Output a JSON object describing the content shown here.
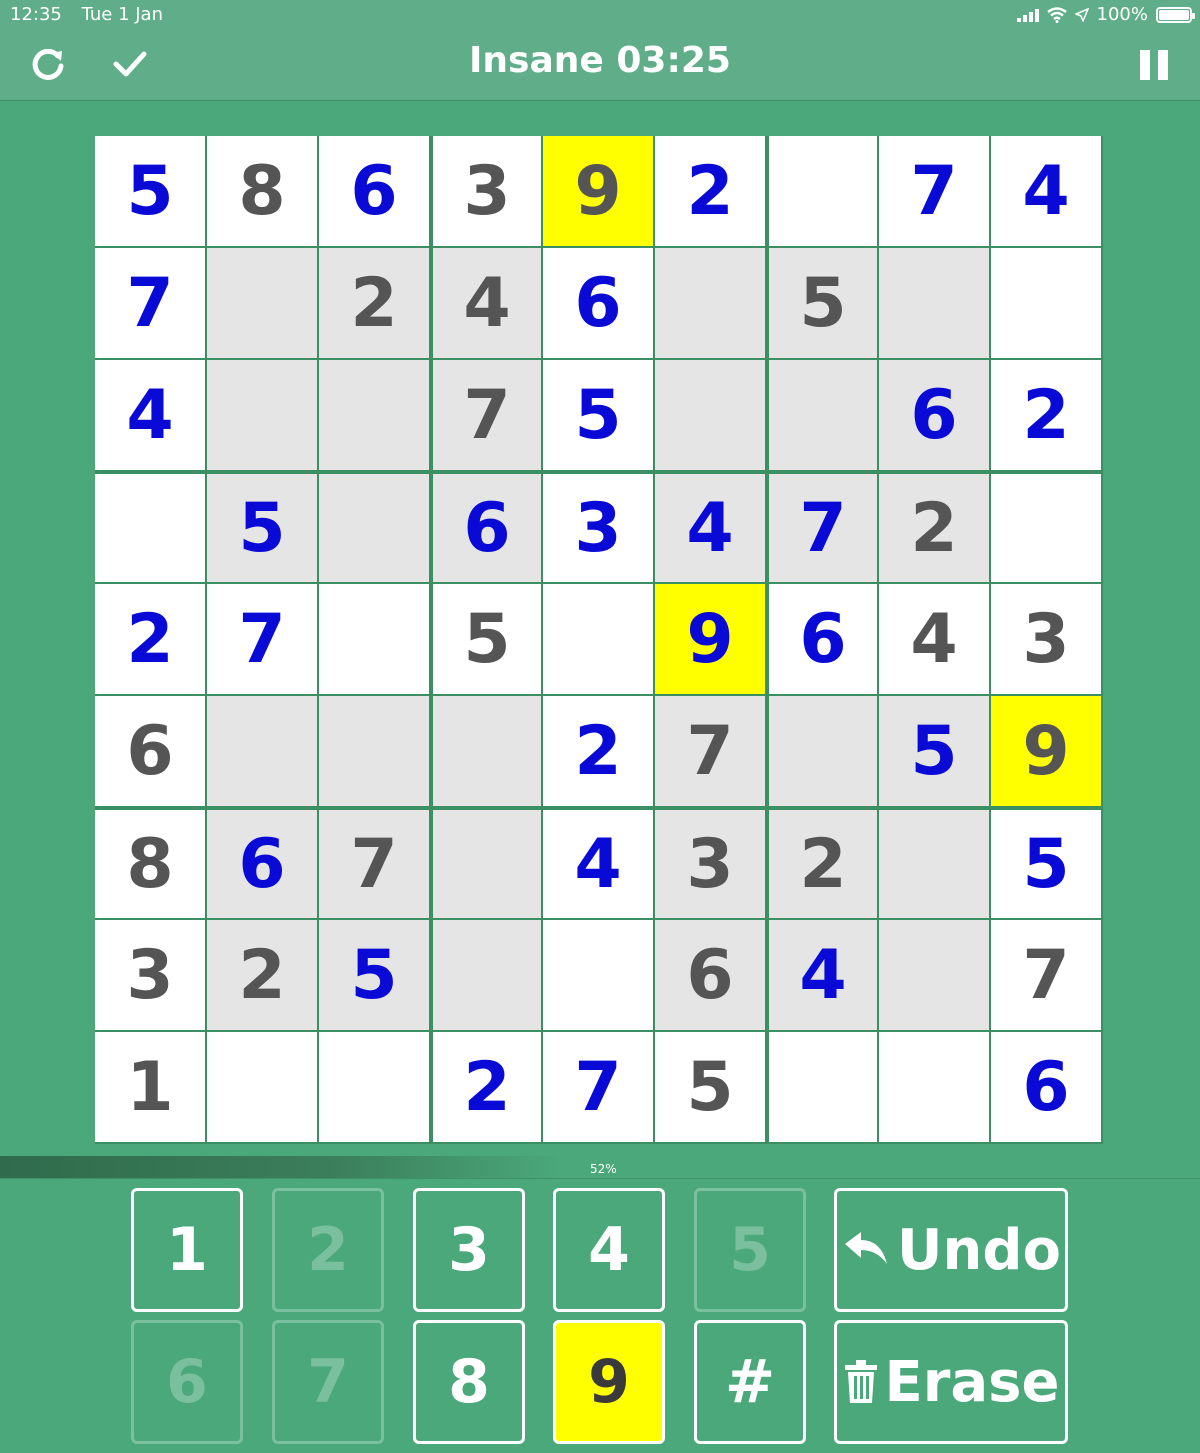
{
  "status_bar": {
    "time": "12:35",
    "date": "Tue 1 Jan",
    "battery": "100%"
  },
  "header": {
    "title": "Insane 03:25"
  },
  "board": {
    "rows": [
      [
        {
          "v": "5",
          "t": "entered",
          "bg": "white"
        },
        {
          "v": "8",
          "t": "given",
          "bg": "white"
        },
        {
          "v": "6",
          "t": "entered",
          "bg": "white"
        },
        {
          "v": "3",
          "t": "given",
          "bg": "white"
        },
        {
          "v": "9",
          "t": "given",
          "bg": "yellow"
        },
        {
          "v": "2",
          "t": "entered",
          "bg": "white"
        },
        {
          "v": "",
          "t": "",
          "bg": "white"
        },
        {
          "v": "7",
          "t": "entered",
          "bg": "white"
        },
        {
          "v": "4",
          "t": "entered",
          "bg": "white"
        }
      ],
      [
        {
          "v": "7",
          "t": "entered",
          "bg": "white"
        },
        {
          "v": "",
          "t": "",
          "bg": "gray"
        },
        {
          "v": "2",
          "t": "given",
          "bg": "gray"
        },
        {
          "v": "4",
          "t": "given",
          "bg": "gray"
        },
        {
          "v": "6",
          "t": "entered",
          "bg": "white"
        },
        {
          "v": "",
          "t": "",
          "bg": "gray"
        },
        {
          "v": "5",
          "t": "given",
          "bg": "gray"
        },
        {
          "v": "",
          "t": "",
          "bg": "gray"
        },
        {
          "v": "",
          "t": "",
          "bg": "white"
        }
      ],
      [
        {
          "v": "4",
          "t": "entered",
          "bg": "white"
        },
        {
          "v": "",
          "t": "",
          "bg": "gray"
        },
        {
          "v": "",
          "t": "",
          "bg": "gray"
        },
        {
          "v": "7",
          "t": "given",
          "bg": "gray"
        },
        {
          "v": "5",
          "t": "entered",
          "bg": "white"
        },
        {
          "v": "",
          "t": "",
          "bg": "gray"
        },
        {
          "v": "",
          "t": "",
          "bg": "gray"
        },
        {
          "v": "6",
          "t": "entered",
          "bg": "gray"
        },
        {
          "v": "2",
          "t": "entered",
          "bg": "white"
        }
      ],
      [
        {
          "v": "",
          "t": "",
          "bg": "white"
        },
        {
          "v": "5",
          "t": "entered",
          "bg": "gray"
        },
        {
          "v": "",
          "t": "",
          "bg": "gray"
        },
        {
          "v": "6",
          "t": "entered",
          "bg": "gray"
        },
        {
          "v": "3",
          "t": "entered",
          "bg": "white"
        },
        {
          "v": "4",
          "t": "entered",
          "bg": "gray"
        },
        {
          "v": "7",
          "t": "entered",
          "bg": "gray"
        },
        {
          "v": "2",
          "t": "given",
          "bg": "gray"
        },
        {
          "v": "",
          "t": "",
          "bg": "white"
        }
      ],
      [
        {
          "v": "2",
          "t": "entered",
          "bg": "white"
        },
        {
          "v": "7",
          "t": "entered",
          "bg": "white"
        },
        {
          "v": "",
          "t": "",
          "bg": "white"
        },
        {
          "v": "5",
          "t": "given",
          "bg": "white"
        },
        {
          "v": "",
          "t": "",
          "bg": "white"
        },
        {
          "v": "9",
          "t": "entered",
          "bg": "yellow"
        },
        {
          "v": "6",
          "t": "entered",
          "bg": "white"
        },
        {
          "v": "4",
          "t": "given",
          "bg": "white"
        },
        {
          "v": "3",
          "t": "given",
          "bg": "white"
        }
      ],
      [
        {
          "v": "6",
          "t": "given",
          "bg": "white"
        },
        {
          "v": "",
          "t": "",
          "bg": "gray"
        },
        {
          "v": "",
          "t": "",
          "bg": "gray"
        },
        {
          "v": "",
          "t": "",
          "bg": "gray"
        },
        {
          "v": "2",
          "t": "entered",
          "bg": "white"
        },
        {
          "v": "7",
          "t": "given",
          "bg": "gray"
        },
        {
          "v": "",
          "t": "",
          "bg": "gray"
        },
        {
          "v": "5",
          "t": "entered",
          "bg": "gray"
        },
        {
          "v": "9",
          "t": "given",
          "bg": "yellow"
        }
      ],
      [
        {
          "v": "8",
          "t": "given",
          "bg": "white"
        },
        {
          "v": "6",
          "t": "entered",
          "bg": "gray"
        },
        {
          "v": "7",
          "t": "given",
          "bg": "gray"
        },
        {
          "v": "",
          "t": "",
          "bg": "gray"
        },
        {
          "v": "4",
          "t": "entered",
          "bg": "white"
        },
        {
          "v": "3",
          "t": "given",
          "bg": "gray"
        },
        {
          "v": "2",
          "t": "given",
          "bg": "gray"
        },
        {
          "v": "",
          "t": "",
          "bg": "gray"
        },
        {
          "v": "5",
          "t": "entered",
          "bg": "white"
        }
      ],
      [
        {
          "v": "3",
          "t": "given",
          "bg": "white"
        },
        {
          "v": "2",
          "t": "given",
          "bg": "gray"
        },
        {
          "v": "5",
          "t": "entered",
          "bg": "gray"
        },
        {
          "v": "",
          "t": "",
          "bg": "gray"
        },
        {
          "v": "",
          "t": "",
          "bg": "white"
        },
        {
          "v": "6",
          "t": "given",
          "bg": "gray"
        },
        {
          "v": "4",
          "t": "entered",
          "bg": "gray"
        },
        {
          "v": "",
          "t": "",
          "bg": "gray"
        },
        {
          "v": "7",
          "t": "given",
          "bg": "white"
        }
      ],
      [
        {
          "v": "1",
          "t": "given",
          "bg": "white"
        },
        {
          "v": "",
          "t": "",
          "bg": "white"
        },
        {
          "v": "",
          "t": "",
          "bg": "white"
        },
        {
          "v": "2",
          "t": "entered",
          "bg": "white"
        },
        {
          "v": "7",
          "t": "entered",
          "bg": "white"
        },
        {
          "v": "5",
          "t": "given",
          "bg": "white"
        },
        {
          "v": "",
          "t": "",
          "bg": "white"
        },
        {
          "v": "",
          "t": "",
          "bg": "white"
        },
        {
          "v": "6",
          "t": "entered",
          "bg": "white"
        }
      ]
    ]
  },
  "progress": {
    "percent": 52,
    "label": "52%"
  },
  "keypad": {
    "keys": [
      {
        "label": "1",
        "state": "enabled"
      },
      {
        "label": "2",
        "state": "disabled"
      },
      {
        "label": "3",
        "state": "enabled"
      },
      {
        "label": "4",
        "state": "enabled"
      },
      {
        "label": "5",
        "state": "disabled"
      },
      {
        "label": "6",
        "state": "disabled"
      },
      {
        "label": "7",
        "state": "disabled"
      },
      {
        "label": "8",
        "state": "enabled"
      },
      {
        "label": "9",
        "state": "active"
      },
      {
        "label": "#",
        "state": "enabled"
      }
    ],
    "undo_label": "Undo",
    "erase_label": "Erase"
  },
  "colors": {
    "background": "#4aa87a",
    "header": "#5fae89",
    "highlight": "#ffff00",
    "entered_digit": "#0a0ad6",
    "given_digit": "#555555"
  },
  "icons": {
    "restart": "refresh-icon",
    "check": "checkmark-icon",
    "pause": "pause-icon",
    "undo": "undo-arrow-icon",
    "erase": "trash-icon"
  }
}
